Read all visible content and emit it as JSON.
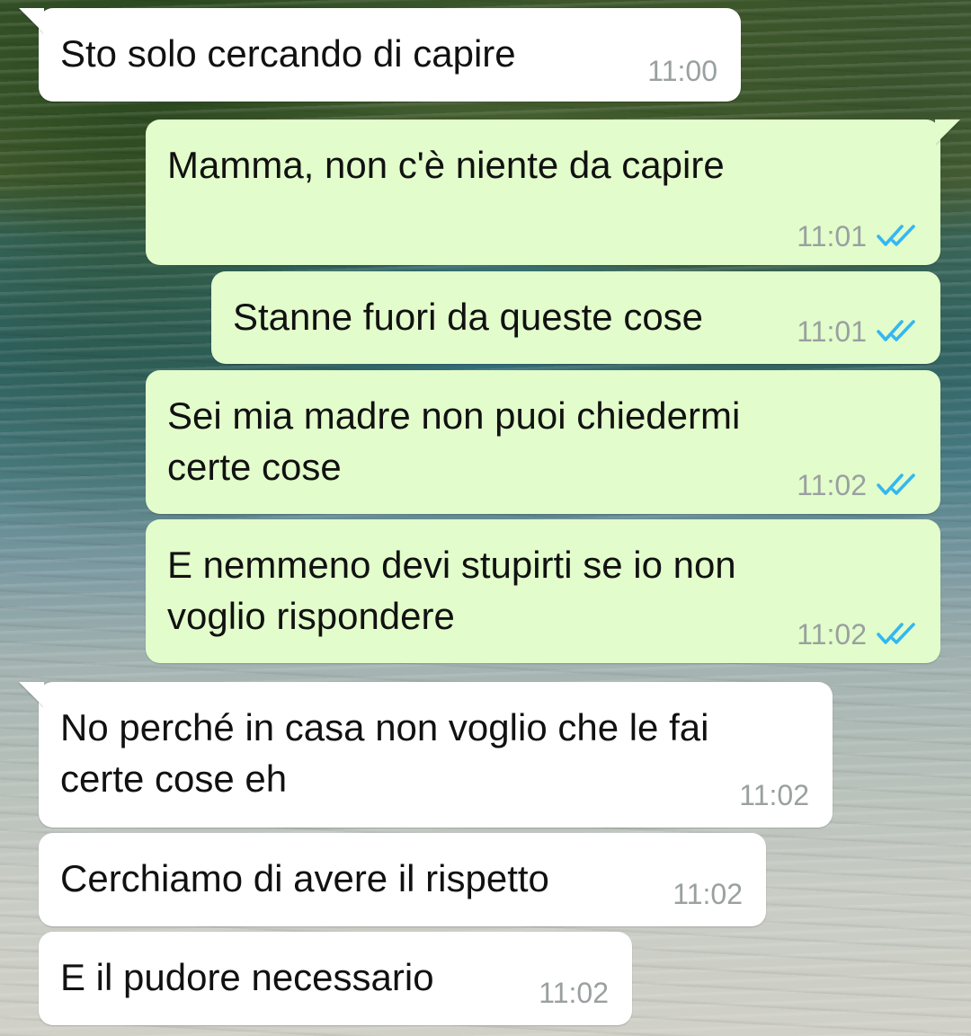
{
  "chat": {
    "messages": [
      {
        "direction": "incoming",
        "text": "Sto solo cercando di capire",
        "time": "11:00"
      },
      {
        "direction": "outgoing",
        "text": "Mamma, non c'è niente da capire",
        "time": "11:01",
        "status": "read",
        "status_icon": "double-check-icon"
      },
      {
        "direction": "outgoing",
        "text": "Stanne fuori da queste cose",
        "time": "11:01",
        "status": "read",
        "status_icon": "double-check-icon"
      },
      {
        "direction": "outgoing",
        "text": "Sei mia madre non puoi chiedermi\ncerte cose",
        "time": "11:02",
        "status": "read",
        "status_icon": "double-check-icon"
      },
      {
        "direction": "outgoing",
        "text": "E nemmeno devi stupirti se io non\nvoglio rispondere",
        "time": "11:02",
        "status": "read",
        "status_icon": "double-check-icon"
      },
      {
        "direction": "incoming",
        "text": "No perché in casa non voglio che le fai\ncerte cose eh",
        "time": "11:02"
      },
      {
        "direction": "incoming",
        "text": "Cerchiamo di avere il rispetto",
        "time": "11:02"
      },
      {
        "direction": "incoming",
        "text": "E il pudore necessario",
        "time": "11:02"
      }
    ]
  },
  "colors": {
    "incoming_bubble": "#ffffff",
    "outgoing_bubble": "#e2fdcb",
    "read_tick": "#34b7f1",
    "time_text": "#9aa0a0"
  }
}
